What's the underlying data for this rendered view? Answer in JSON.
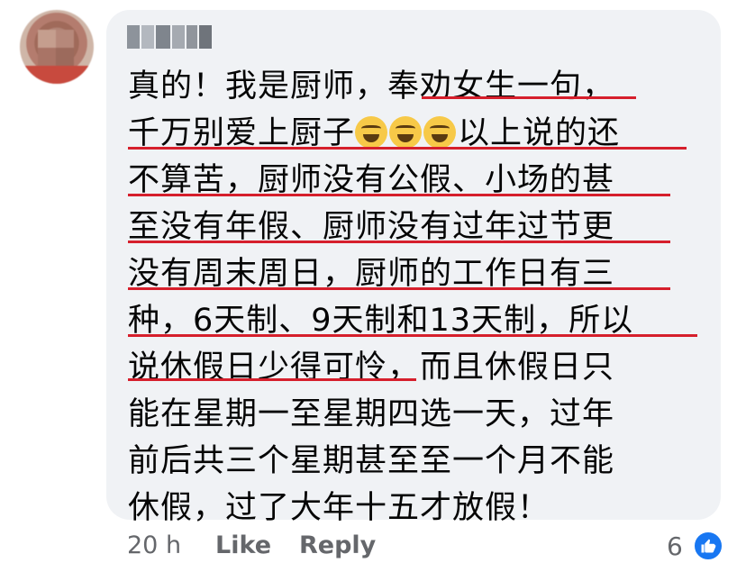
{
  "comment": {
    "lines": [
      "真的！我是厨师，奉劝女生一句，",
      "千万别爱上厨子",
      "以上说的还",
      "不算苦，厨师没有公假、小场的甚",
      "至没有年假、厨师没有过年过节更",
      "没有周末周日，厨师的工作日有三",
      "种，6天制、9天制和13天制，所以",
      "说休假日少得可怜，而且休假日只",
      "能在星期一至星期四选一天，过年",
      "前后共三个星期甚至至一个月不能",
      "休假，过了大年十五才放假！"
    ]
  },
  "emojis": [
    "grinning-squinting-face",
    "grinning-squinting-face",
    "grinning-squinting-face"
  ],
  "actions": {
    "time": "20 h",
    "like": "Like",
    "reply": "Reply"
  },
  "reactions": {
    "count": "6",
    "type": "like",
    "color": "#1877f2"
  },
  "colors": {
    "underline": "#d61f2c",
    "bubble": "#f0f2f5",
    "meta": "#65676b"
  }
}
